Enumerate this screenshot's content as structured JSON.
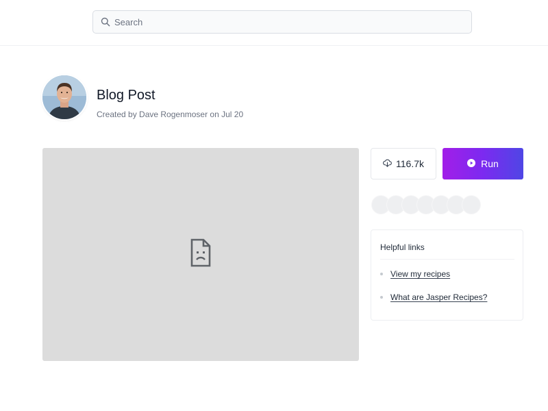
{
  "search": {
    "placeholder": "Search"
  },
  "header": {
    "title": "Blog Post",
    "subtitle": "Created by Dave Rogenmoser on Jul 20"
  },
  "stats": {
    "downloads": "116.7k"
  },
  "actions": {
    "run_label": "Run"
  },
  "helpful_links": {
    "title": "Helpful links",
    "items": [
      {
        "label": "View my recipes"
      },
      {
        "label": "What are Jasper Recipes?"
      }
    ]
  },
  "colors": {
    "run_gradient_start": "#a21ee8",
    "run_gradient_end": "#4f46e5",
    "preview_bg": "#dcdcdc"
  },
  "icons": {
    "search": "search-icon",
    "downloads": "download-cloud-icon",
    "run": "play-circle-icon",
    "broken_preview": "broken-file-icon"
  }
}
